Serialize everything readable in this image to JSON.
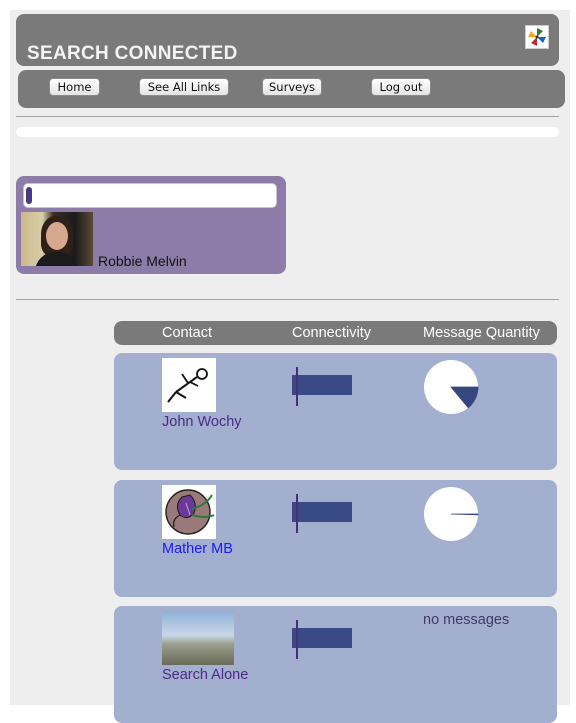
{
  "app": {
    "title": "SEARCH CONNECTED"
  },
  "nav": {
    "home": "Home",
    "see_all_links": "See All Links",
    "surveys": "Surveys",
    "log_out": "Log out"
  },
  "profile": {
    "name": "Robbie Melvin",
    "status_value": ""
  },
  "table": {
    "headers": [
      "Contact",
      "Connectivity",
      "Message Quantity"
    ],
    "rows": [
      {
        "name": "John Wochy",
        "name_color": "#4b2a86",
        "thumbnail": "stick-figure-icon",
        "connectivity": 0.6,
        "message_fraction": 0.14,
        "message_text": ""
      },
      {
        "name": "Mather MB",
        "name_color": "#1a1aff",
        "thumbnail": "flower-icon",
        "connectivity": 0.6,
        "message_fraction": 0.005,
        "message_text": ""
      },
      {
        "name": "Search Alone",
        "name_color": "#4b2a86",
        "thumbnail": "landscape-photo",
        "connectivity": 0.6,
        "message_fraction": null,
        "message_text": "no messages"
      }
    ]
  },
  "colors": {
    "header_gray": "#7a7a7a",
    "profile_card": "#8d7ca8",
    "row_bg": "#a3afcf",
    "bar_blue": "#3a4a86",
    "pie_fill": "#36467e",
    "axis_purple": "#4a2d7a"
  }
}
